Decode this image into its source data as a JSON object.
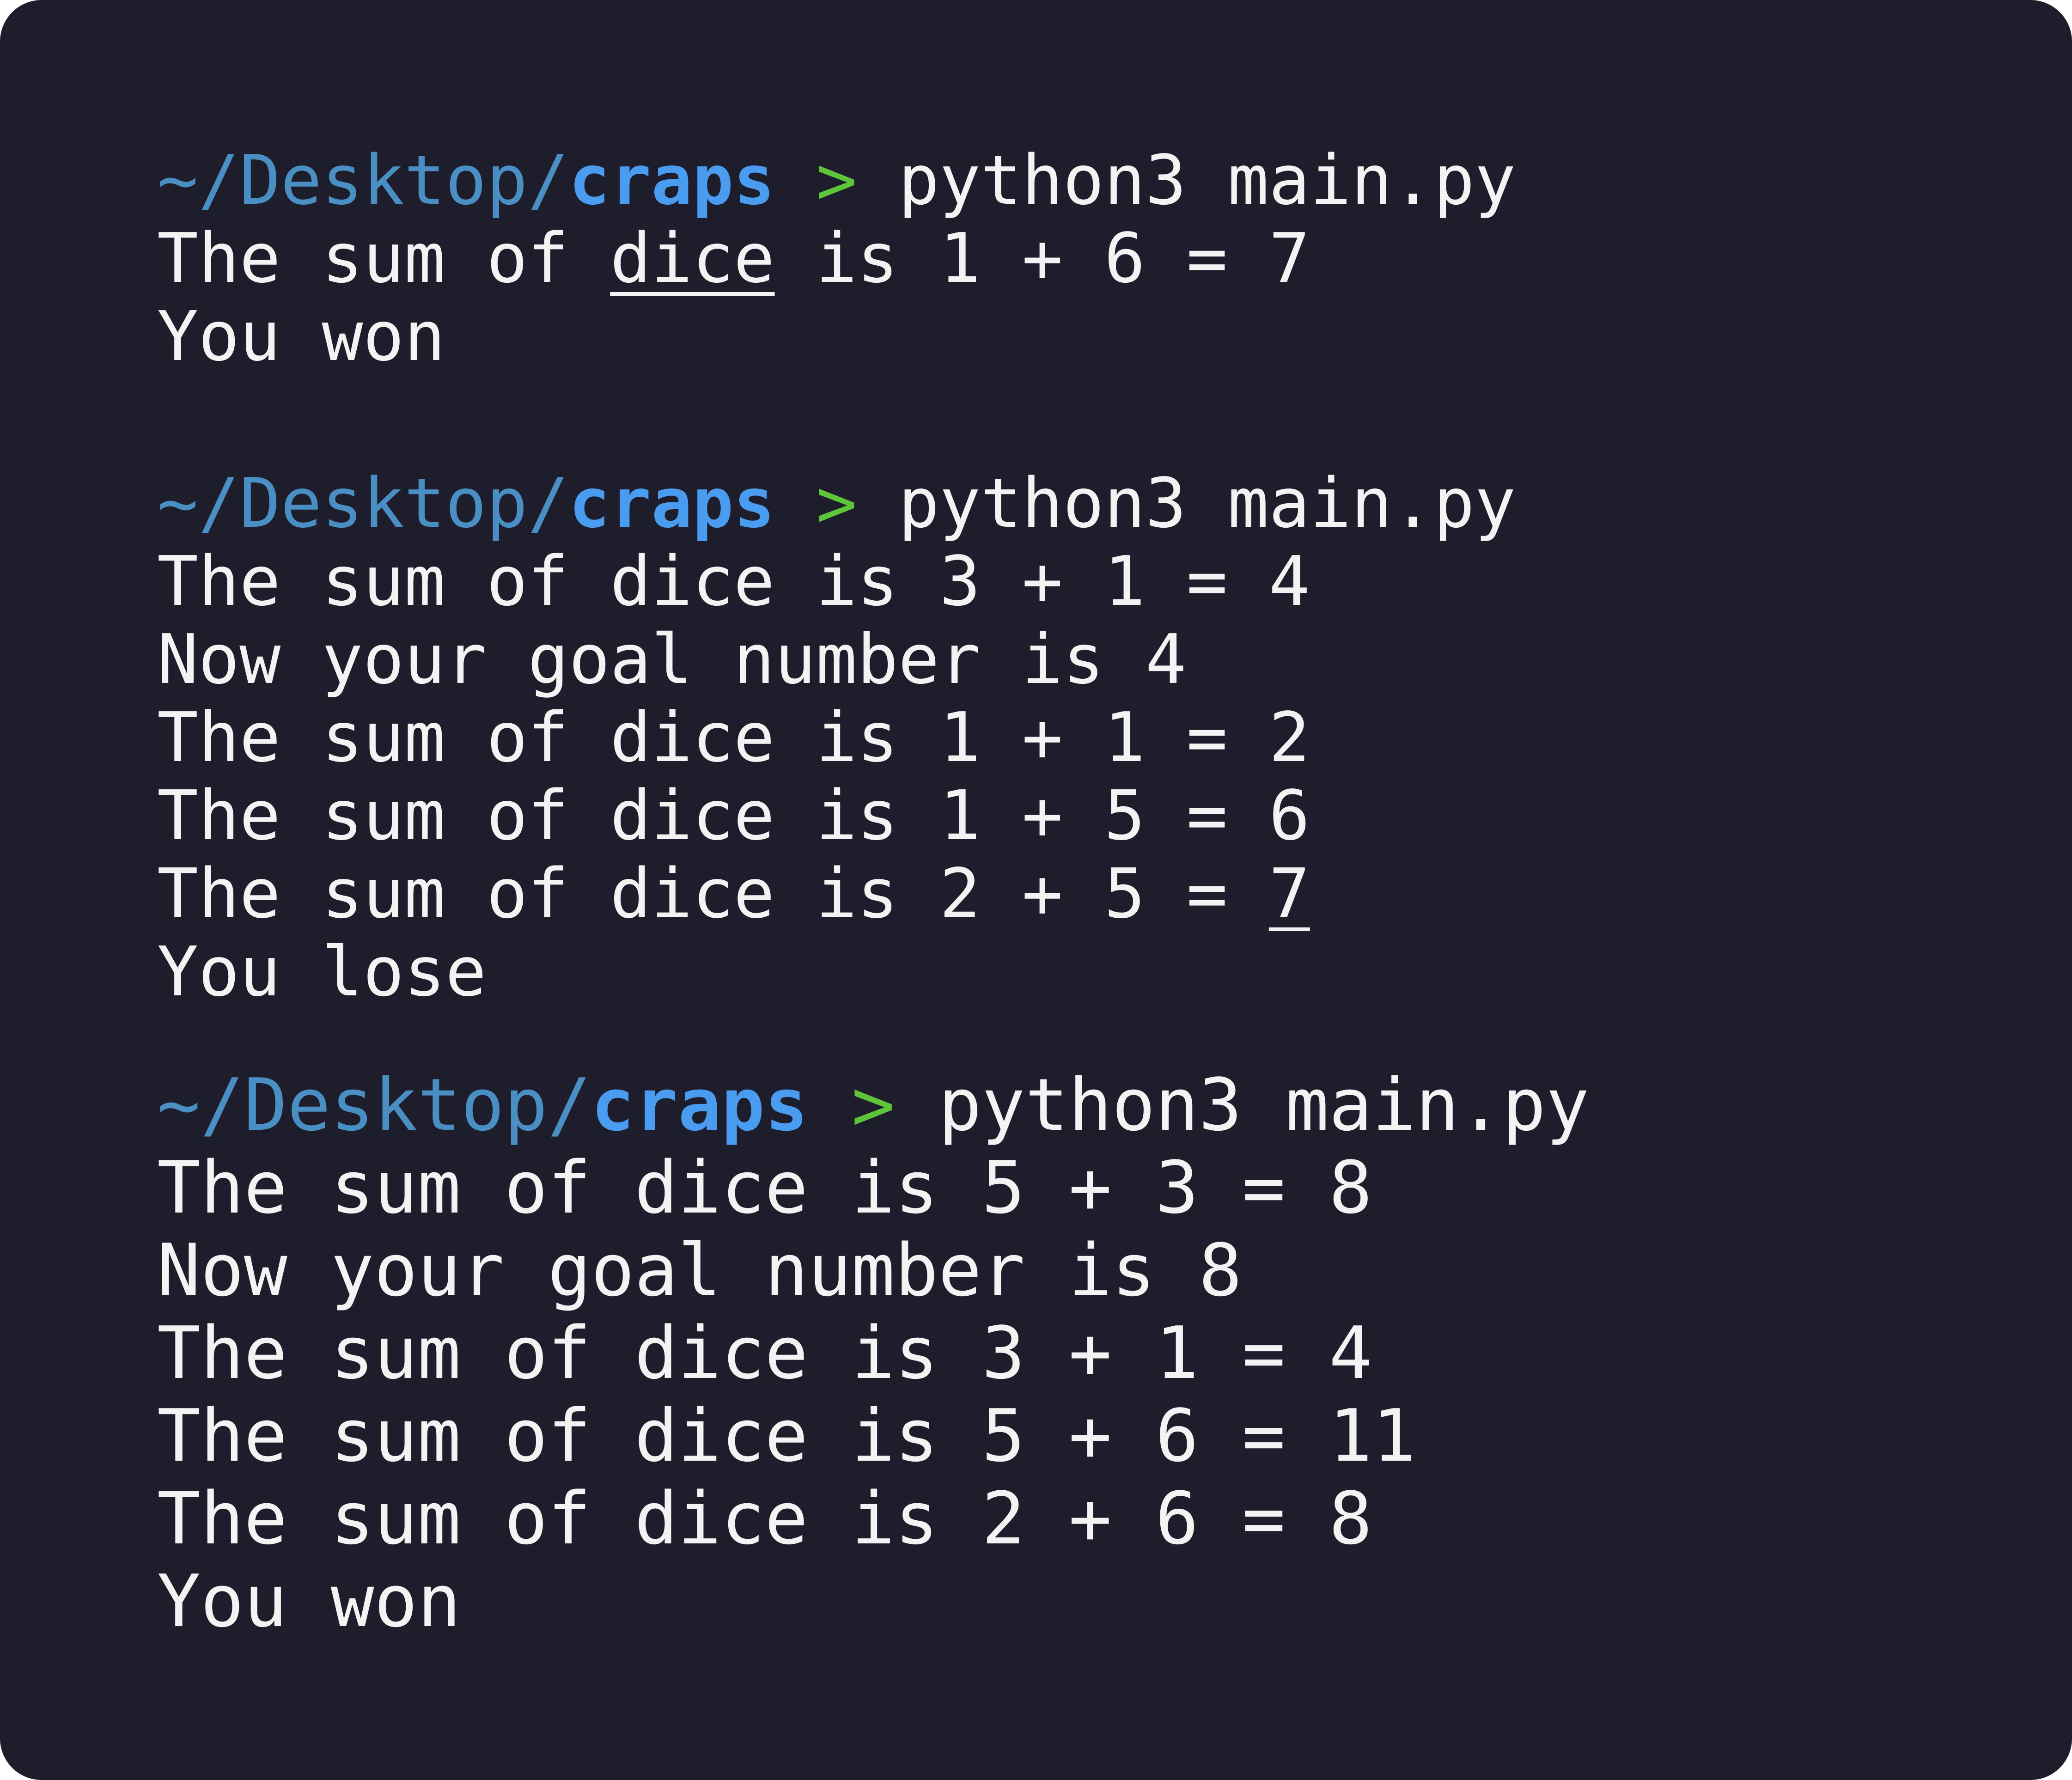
{
  "theme": {
    "background": "#1e1d2b",
    "text": "#f3f3f3",
    "path_color": "#4a8fc4",
    "dir_color": "#4a9cf0",
    "arrow_color": "#5ec43a"
  },
  "sessions": [
    {
      "prompt": {
        "path": "~/Desktop/",
        "dir": "craps",
        "arrow": ">",
        "command": "python3 main.py"
      },
      "output": {
        "line1_a": "The sum of ",
        "line1_u": "dice",
        "line1_b": " is 1 + 6 = 7",
        "line2": "You won"
      }
    },
    {
      "prompt": {
        "path": "~/Desktop/",
        "dir": "craps",
        "arrow": ">",
        "command": "python3 main.py"
      },
      "output": {
        "line1": "The sum of dice is 3 + 1 = 4",
        "line2": "Now your goal number is 4",
        "line3": "The sum of dice is 1 + 1 = 2",
        "line4": "The sum of dice is 1 + 5 = 6",
        "line5_a": "The sum of dice is 2 + 5 = ",
        "line5_u": "7",
        "line6": "You lose"
      }
    },
    {
      "prompt": {
        "path": "~/Desktop/",
        "dir": "craps",
        "arrow": ">",
        "command": "python3 main.py"
      },
      "output": {
        "line1": "The sum of dice is 5 + 3 = 8",
        "line2": "Now your goal number is 8",
        "line3": "The sum of dice is 3 + 1 = 4",
        "line4": "The sum of dice is 5 + 6 = 11",
        "line5": "The sum of dice is 2 + 6 = 8",
        "line6": "You won"
      }
    }
  ]
}
